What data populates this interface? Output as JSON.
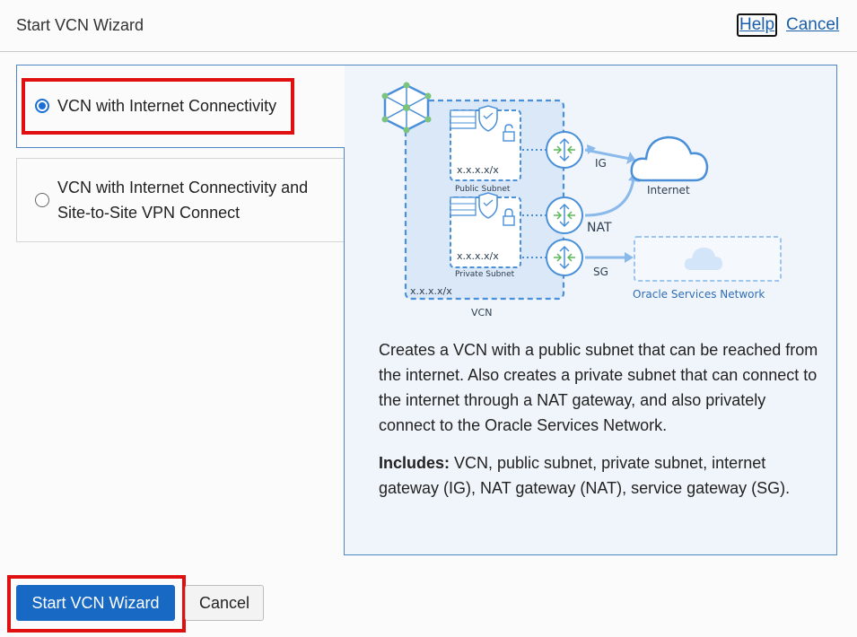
{
  "header": {
    "title": "Start VCN Wizard",
    "help_label": "Help",
    "cancel_label": "Cancel"
  },
  "options": [
    {
      "label": "VCN with Internet Connectivity",
      "selected": true
    },
    {
      "label_line1": "VCN with Internet Connectivity and",
      "label_line2": "Site-to-Site VPN Connect",
      "selected": false
    }
  ],
  "diagram": {
    "public_subnet_cidr": "x.x.x.x/x",
    "public_subnet_label": "Public Subnet",
    "private_subnet_cidr": "x.x.x.x/x",
    "private_subnet_label": "Private Subnet",
    "vcn_cidr": "x.x.x.x/x",
    "vcn_label": "VCN",
    "ig_label": "IG",
    "nat_label": "NAT",
    "sg_label": "SG",
    "internet_label": "Internet",
    "osn_label": "Oracle Services Network",
    "accent_color": "#4a90d9",
    "gateway_arrow_color": "#5cb85c"
  },
  "description": "Creates a VCN with a public subnet that can be reached from the internet. Also creates a private subnet that can connect to the internet through a NAT gateway, and also privately connect to the Oracle Services Network.",
  "includes": {
    "label": "Includes:",
    "text": " VCN, public subnet, private subnet, internet gateway (IG), NAT gateway (NAT), service gateway (SG)."
  },
  "footer": {
    "start_label": "Start VCN Wizard",
    "cancel_label": "Cancel"
  },
  "colors": {
    "primary_button": "#1769c4",
    "highlight_box": "#e01010",
    "link": "#1a5fa8",
    "panel_bg": "#f0f5fb"
  }
}
